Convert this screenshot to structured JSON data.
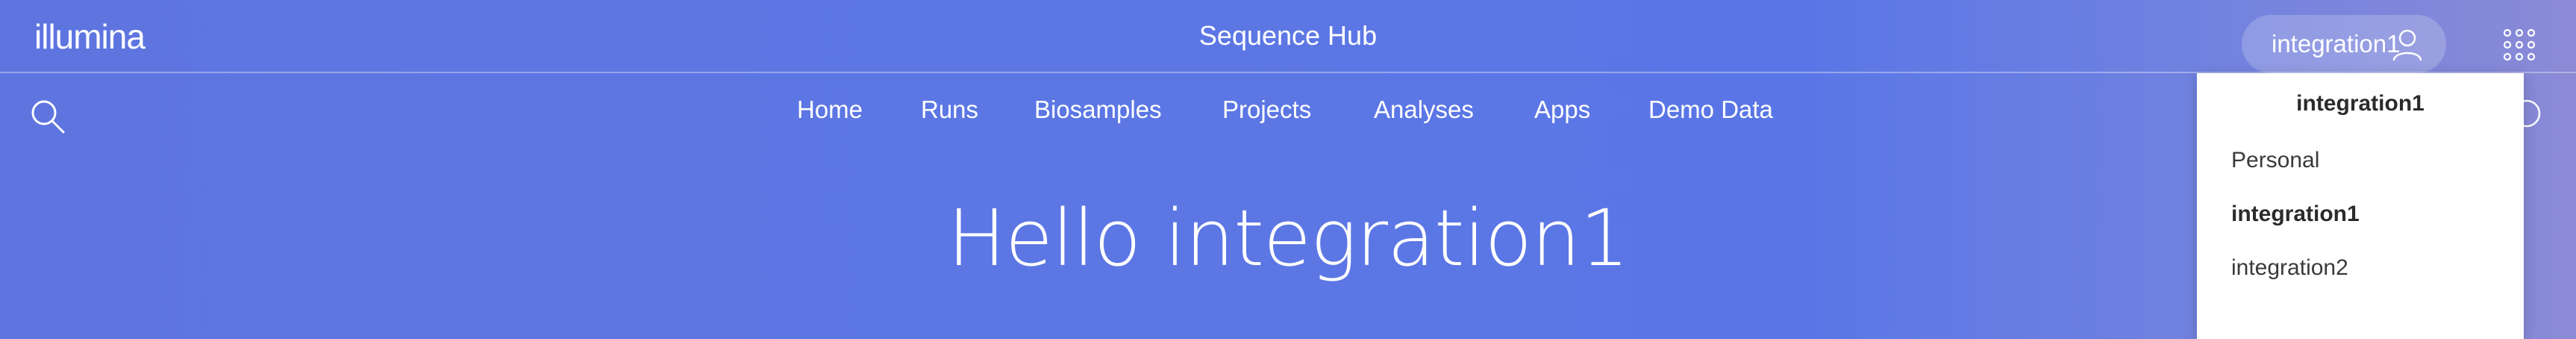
{
  "header": {
    "logo_text": "illumina",
    "app_title": "Sequence Hub",
    "user_label": "integration1",
    "user_icon": "user-icon",
    "apps_icon": "apps-grid-icon"
  },
  "nav": {
    "search_icon": "search-icon",
    "items": [
      {
        "label": "Home"
      },
      {
        "label": "Runs"
      },
      {
        "label": "Biosamples"
      },
      {
        "label": "Projects"
      },
      {
        "label": "Analyses"
      },
      {
        "label": "Apps"
      },
      {
        "label": "Demo Data"
      }
    ]
  },
  "main": {
    "greeting": "Hello integration1"
  },
  "workgroup_menu": {
    "header": "integration1",
    "items": [
      {
        "label": "Personal",
        "active": false
      },
      {
        "label": "integration1",
        "active": true
      },
      {
        "label": "integration2",
        "active": false
      }
    ]
  },
  "colors": {
    "background": "#5c77e4",
    "text": "#ffffff",
    "menu_bg": "#ffffff",
    "menu_text": "#333333"
  }
}
